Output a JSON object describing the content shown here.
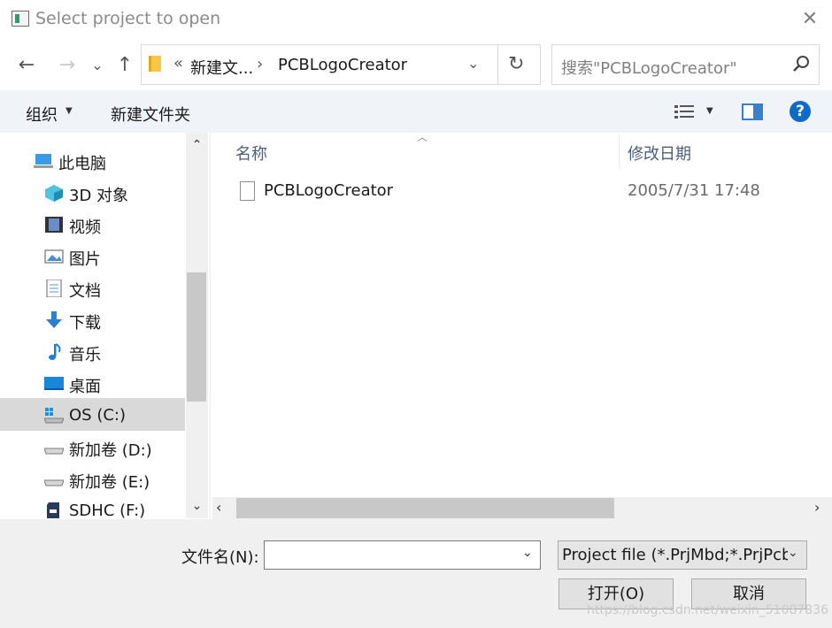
{
  "title": "Select project to open",
  "nav": {
    "back": "←",
    "forward": "→",
    "recent": "⌄",
    "up": "↑"
  },
  "address": {
    "overflow": "«",
    "segments": [
      "新建文...",
      "PCBLogoCreator"
    ],
    "chevron": "›",
    "dropdown": "⌄",
    "refresh": "↻"
  },
  "search": {
    "placeholder": "搜索\"PCBLogoCreator\""
  },
  "toolbar": {
    "organize": "组织",
    "new_folder": "新建文件夹",
    "help": "?"
  },
  "tree": {
    "items": [
      {
        "label": "此电脑",
        "icon": "computer-icon"
      },
      {
        "label": "3D 对象",
        "icon": "3d-objects-icon"
      },
      {
        "label": "视频",
        "icon": "video-icon"
      },
      {
        "label": "图片",
        "icon": "pictures-icon"
      },
      {
        "label": "文档",
        "icon": "documents-icon"
      },
      {
        "label": "下载",
        "icon": "download-icon"
      },
      {
        "label": "音乐",
        "icon": "music-icon"
      },
      {
        "label": "桌面",
        "icon": "desktop-icon"
      },
      {
        "label": "OS (C:)",
        "icon": "drive-c-icon",
        "selected": true
      },
      {
        "label": "新加卷 (D:)",
        "icon": "drive-icon"
      },
      {
        "label": "新加卷 (E:)",
        "icon": "drive-icon"
      },
      {
        "label": "SDHC (F:)",
        "icon": "sd-card-icon"
      }
    ]
  },
  "list": {
    "columns": {
      "name": "名称",
      "date": "修改日期"
    },
    "files": [
      {
        "name": "PCBLogoCreator",
        "modified": "2005/7/31 17:48"
      }
    ]
  },
  "footer": {
    "filename_label": "文件名(N):",
    "filename_value": "",
    "filter": "Project file (*.PrjMbd;*.PrjPcb",
    "open": "打开(O)",
    "cancel": "取消"
  },
  "watermark": "https://blog.csdn.net/weixin_51087836",
  "colors": {
    "accent": "#0f6ac8",
    "toolbar_bg": "#f0f4f9",
    "selection": "#d9d9d9"
  }
}
